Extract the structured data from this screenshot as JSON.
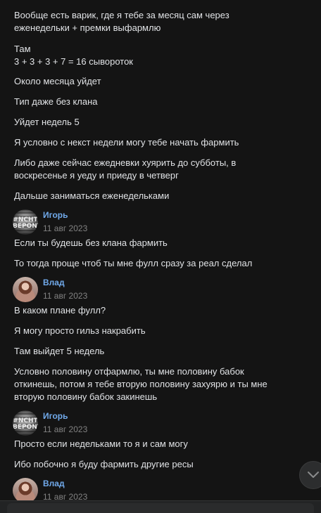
{
  "messages": [
    {
      "text": "Вообще есть варик, где я тебе за месяц сам через\nеженедельки + премки выфармлю"
    },
    {
      "text": "Там\n3 + 3 + 3 + 7 = 16 сывороток"
    },
    {
      "text": "Около месяца уйдет"
    },
    {
      "text": "Тип даже без клана"
    },
    {
      "text": "Уйдет недель 5"
    },
    {
      "text": "Я условно с некст недели могу тебе начать фармить"
    },
    {
      "text": "Либо даже сейчас ежедневки хуярить до субботы, в\nвоскресенье я уеду и приеду в четверг"
    },
    {
      "text": "Дальше заниматься еженедельками"
    },
    {
      "author": "Игорь",
      "time": "11 авг 2023",
      "avatar_text": "#NCHT\nBEPONT"
    },
    {
      "text": "Если ты будешь без клана фармить"
    },
    {
      "text": "То тогда проще чтоб ты мне фулл сразу за реал сделал"
    },
    {
      "author": "Влад",
      "time": "11 авг 2023"
    },
    {
      "text": "В каком плане фулл?"
    },
    {
      "text": "Я могу просто гильз накрабить"
    },
    {
      "text": "Там выйдет 5 недель"
    },
    {
      "text": "Условно половину отфармлю, ты мне половину бабок\nоткинешь, потом я тебе вторую половину захуярю и ты мне\nвторую половину бабок закинешь"
    },
    {
      "author": "Игорь",
      "time": "11 авг 2023",
      "avatar_text": "#NCHT\nBEPONT"
    },
    {
      "text": "Просто если недельками то я и сам могу"
    },
    {
      "text": "Ибо побочно я буду фармить другие ресы"
    },
    {
      "author": "Влад",
      "time": "11 авг 2023"
    }
  ],
  "icons": {
    "scroll_down": "chevron-down-icon"
  },
  "colors": {
    "background": "#141414",
    "author_link": "#71aaeb",
    "timestamp": "#828282"
  }
}
